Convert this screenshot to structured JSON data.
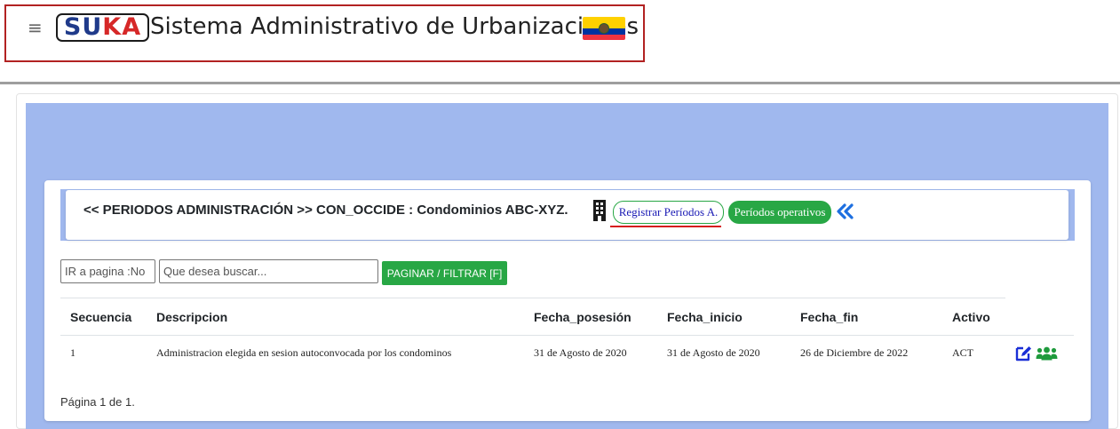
{
  "app": {
    "logo_part1": "SU",
    "logo_part2": "KA",
    "title": "Sistema Administrativo de Urbanizaciones",
    "flag_icon": "ecuador-flag-icon"
  },
  "colors": {
    "accent_blue": "#a0b8ee",
    "button_green": "#28a745",
    "logo_blue": "#1f3a8a",
    "logo_red": "#d62828",
    "brand_border": "#b22222"
  },
  "header": {
    "heading": "<< PERIODOS ADMINISTRACIÓN >> CON_OCCIDE : Condominios ABC-XYZ.",
    "building_icon": "building-icon",
    "registrar_label": "Registrar Períodos A.",
    "periodos_label": "Períodos operativos",
    "back_icon": "double-chevron-left-icon"
  },
  "filters": {
    "goto_placeholder": "IR a pagina :No",
    "search_placeholder": "Que desea buscar...",
    "filter_label": "PAGINAR / FILTRAR [F]"
  },
  "table": {
    "columns": [
      "Secuencia",
      "Descripcion",
      "Fecha_posesión",
      "Fecha_inicio",
      "Fecha_fin",
      "Activo"
    ],
    "rows": [
      {
        "secuencia": "1",
        "descripcion": "Administracion elegida en sesion autoconvocada por los condominos",
        "fecha_posesion": "31 de Agosto de 2020",
        "fecha_inicio": "31 de Agosto de 2020",
        "fecha_fin": "26 de Diciembre de 2022",
        "activo": "ACT",
        "actions": [
          "edit-icon",
          "users-icon"
        ]
      }
    ]
  },
  "footer": {
    "pagination": "Página 1 de 1."
  }
}
